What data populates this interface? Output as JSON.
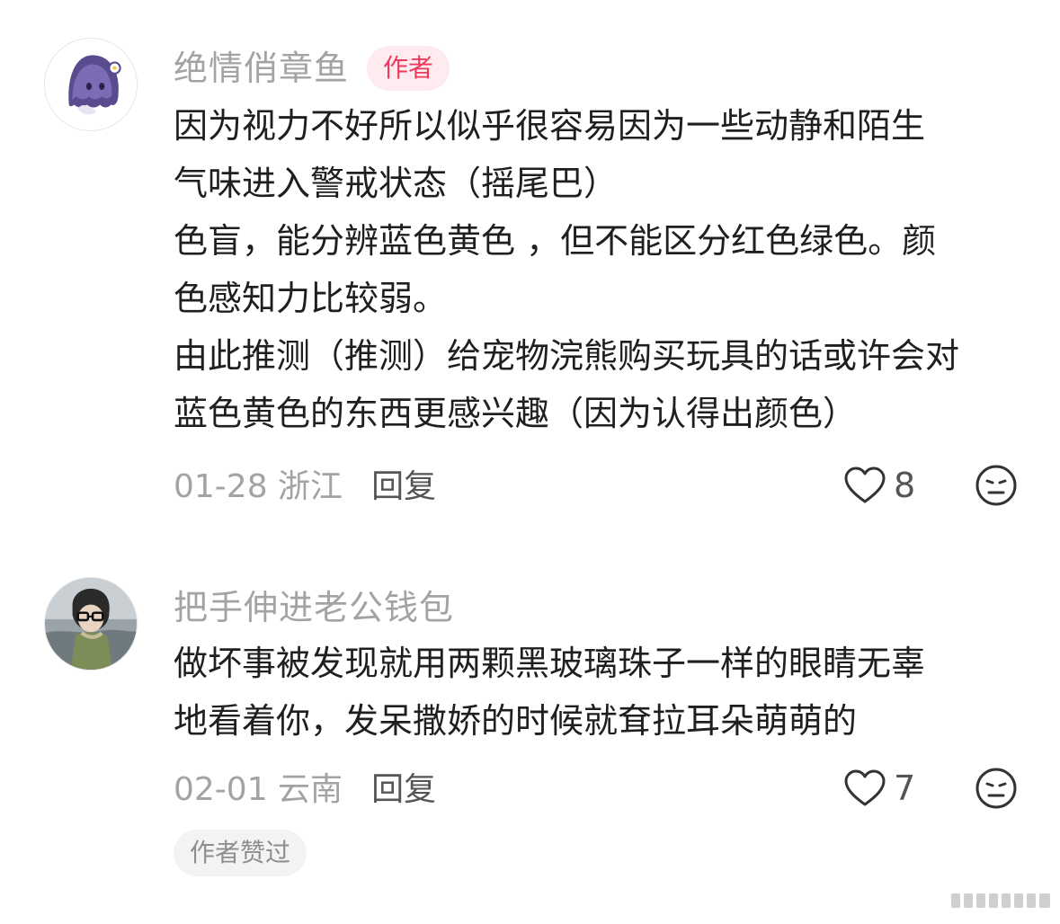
{
  "comments": [
    {
      "username": "绝情俏章鱼",
      "author_tag": "作者",
      "avatar_icon": "ghost-avatar-icon",
      "lines": [
        "因为视力不好所以似乎很容易因为一些动静和陌生",
        "气味进入警戒状态（摇尾巴）",
        "色盲，能分辨蓝色黄色 ，但不能区分红色绿色。颜",
        "色感知力比较弱。",
        "由此推测（推测）给宠物浣熊购买玩具的话或许会对",
        "蓝色黄色的东西更感兴趣（因为认得出颜色）"
      ],
      "date_location": "01-28 浙江",
      "reply_label": "回复",
      "like_count": "8"
    },
    {
      "username": "把手伸进老公钱包",
      "avatar_icon": "person-photo-avatar-icon",
      "lines": [
        "做坏事被发现就用两颗黑玻璃珠子一样的眼睛无辜",
        "地看着你，发呆撒娇的时候就耷拉耳朵萌萌的"
      ],
      "date_location": "02-01 云南",
      "reply_label": "回复",
      "like_count": "7",
      "liked_badge": "作者赞过"
    }
  ],
  "colors": {
    "author_tag_text": "#ee3a5c",
    "author_tag_bg": "#fdebef",
    "muted_text": "#a3a3a3",
    "body_text": "#1f1f1f"
  }
}
